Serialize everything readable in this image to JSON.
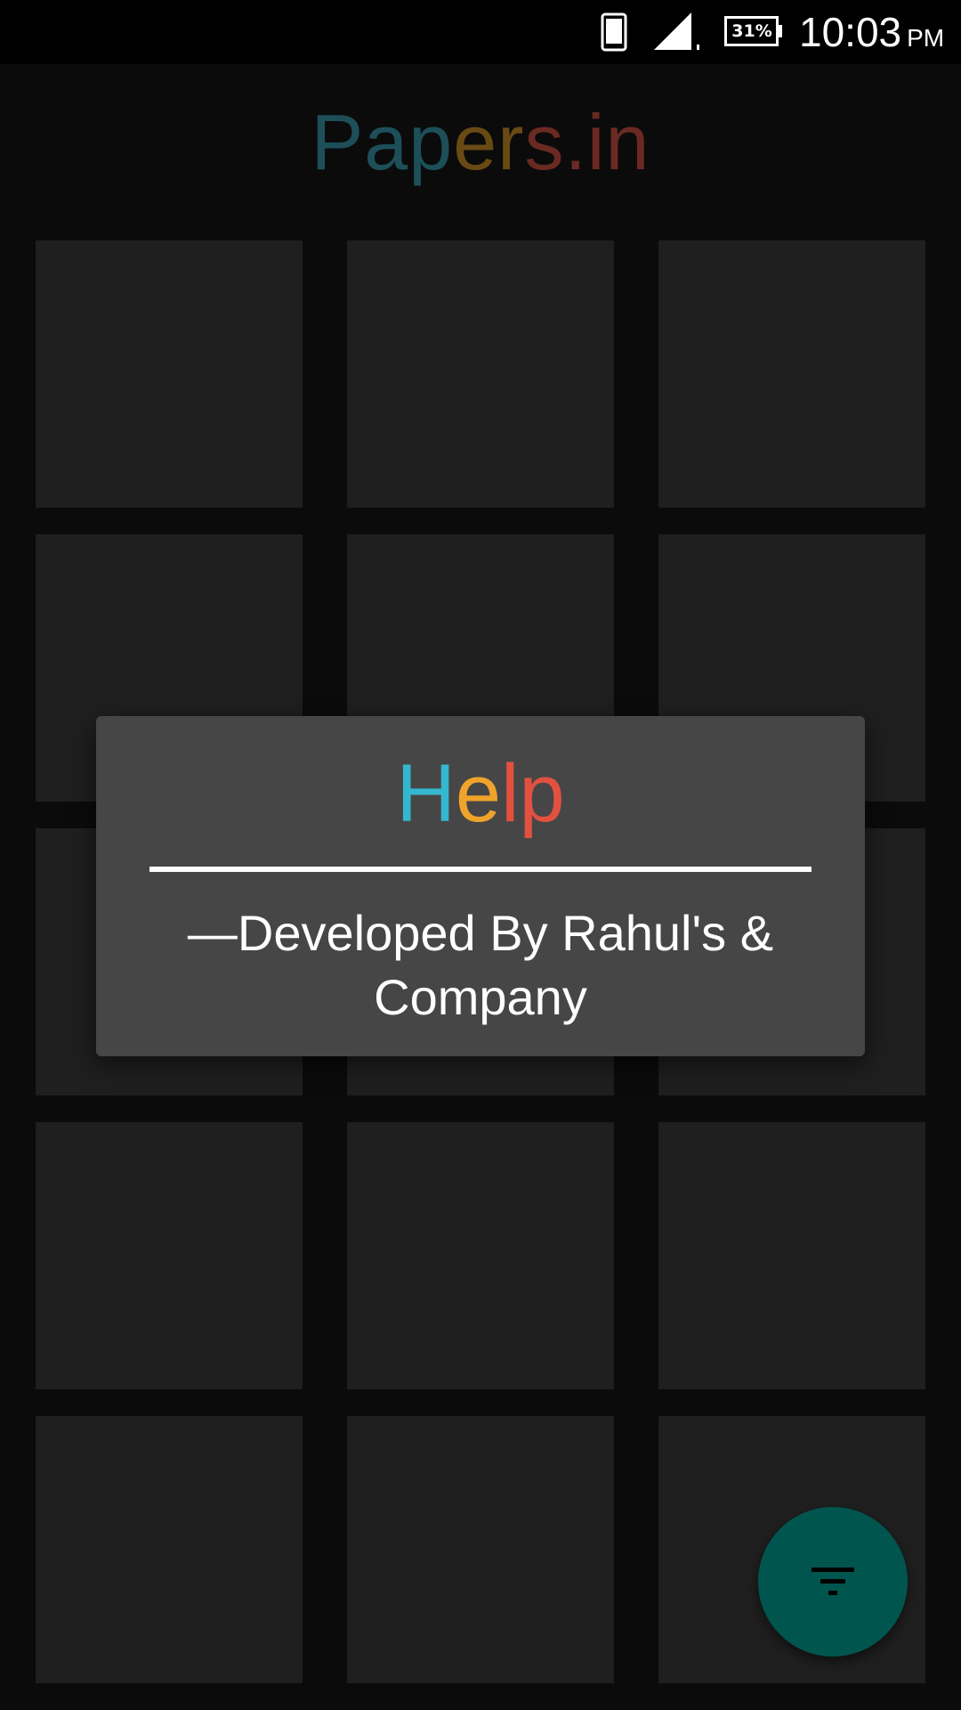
{
  "status_bar": {
    "battery_text": "31%",
    "time": "10:03",
    "ampm": "PM",
    "icons": [
      "phone-icon",
      "signal-icon",
      "battery-icon"
    ]
  },
  "app_bar": {
    "title_parts": [
      {
        "text": "Pa",
        "color": "#1c4d56"
      },
      {
        "text": "pers",
        "color": "#1c4d56"
      },
      {
        "text": ".",
        "color": "#6a2a22"
      },
      {
        "text": "in",
        "color": "#6a2a22"
      }
    ],
    "title_colors": {
      "P": "#1d4f59",
      "a": "#1d4f59",
      "p": "#1d4f59",
      "e": "#6a4a14",
      "r": "#6a4a14",
      "s": "#6a2a22",
      "dot": "#6a2a22",
      "in": "#6a2a22"
    }
  },
  "dialog": {
    "title_letters": [
      {
        "text": "H",
        "color": "#35b7cf"
      },
      {
        "text": "e",
        "color": "#efa32a"
      },
      {
        "text": "l",
        "color": "#e2513f"
      },
      {
        "text": "p",
        "color": "#e2513f"
      }
    ],
    "message_line1": "—Developed By Rahul's &",
    "message_line2": "Company"
  },
  "fab": {
    "icon": "filter-icon",
    "color": "#00564f"
  },
  "colors": {
    "background": "#0b0b0b",
    "tile": "#1f1f1f",
    "dialog_bg": "#464646"
  }
}
